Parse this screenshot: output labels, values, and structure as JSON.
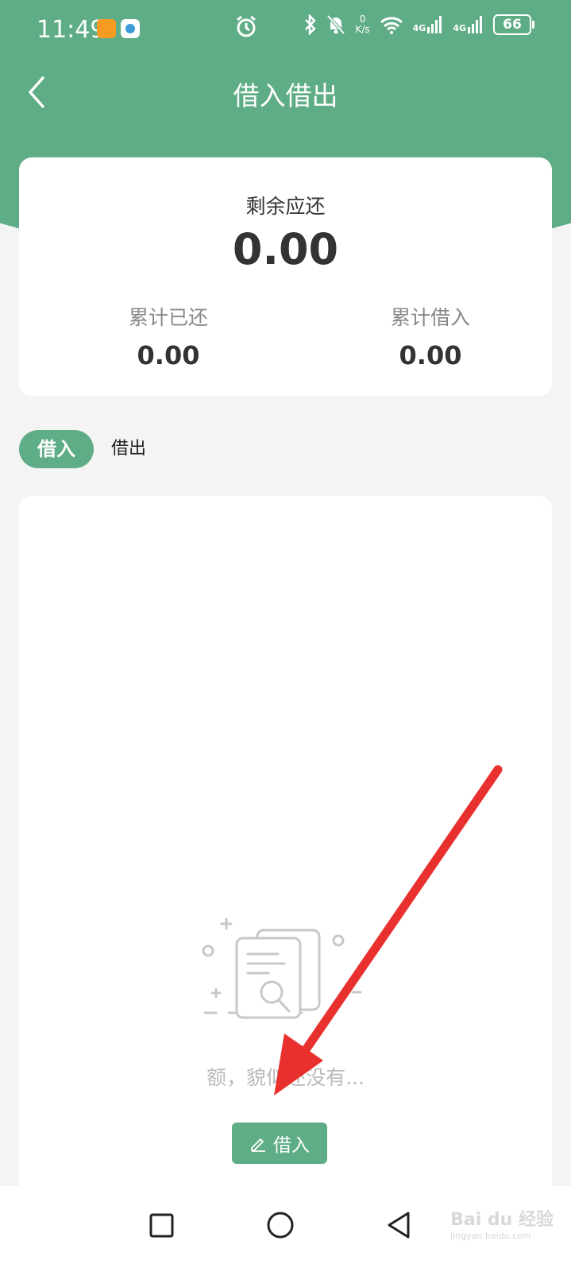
{
  "status_bar": {
    "time": "11:49",
    "net_speed_value": "0",
    "net_speed_unit": "K/s",
    "signal_1": "4G",
    "signal_2": "4G",
    "battery": "66"
  },
  "header": {
    "title": "借入借出"
  },
  "summary": {
    "remaining_label": "剩余应还",
    "remaining_value": "0.00",
    "repaid_label": "累计已还",
    "repaid_value": "0.00",
    "borrowed_label": "累计借入",
    "borrowed_value": "0.00"
  },
  "tabs": [
    {
      "label": "借入",
      "active": true
    },
    {
      "label": "借出",
      "active": false
    }
  ],
  "empty_state": {
    "message": "额，貌似还没有...",
    "button_label": "借入"
  },
  "watermark": {
    "brand": "Bai du 经验",
    "url": "jingyan.baidu.com"
  },
  "colors": {
    "accent": "#5fad86",
    "arrow": "#e8312f"
  }
}
